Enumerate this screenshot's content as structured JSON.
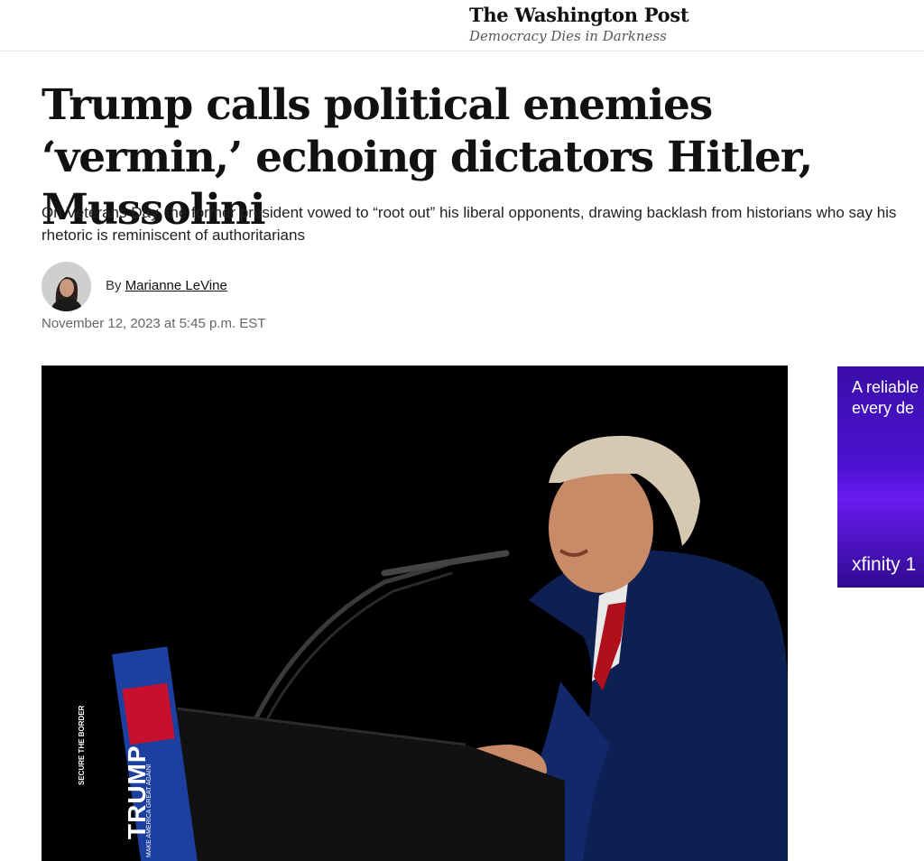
{
  "masthead": {
    "logo": "The Washington Post",
    "tagline": "Democracy Dies in Darkness"
  },
  "article": {
    "headline": "Trump calls political enemies ‘vermin,’ echoing dictators Hitler, Mussolini",
    "subheadline": "On Veterans Day, the former president vowed to “root out” his liberal opponents, drawing backlash from historians who say his rhetoric is reminiscent of authoritarians",
    "byline_prefix": "By",
    "author": "Marianne LeVine",
    "timestamp": "November 12, 2023 at 5:45 p.m. EST",
    "hero_image": {
      "podium_sign_tagline": "SECURE THE BORDER",
      "podium_sign_name": "TRUMP",
      "podium_sign_footer": "MAKE AMERICA GREAT AGAIN!"
    }
  },
  "ad": {
    "copy": "A reliable\nevery de",
    "brand": "xfinity 1"
  },
  "colors": {
    "ad_purple": "#4c12d2",
    "sign_blue": "#1d3fa0",
    "sign_red": "#c8102e"
  }
}
